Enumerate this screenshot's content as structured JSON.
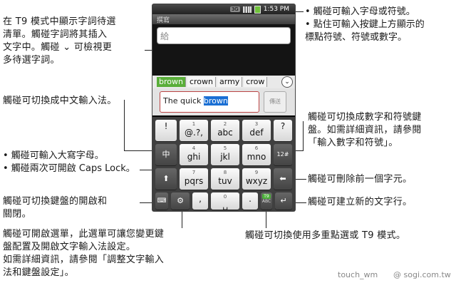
{
  "annotations": {
    "t9_candidates": "在 T9 模式中顯示字詞待選\n清單。觸碰字詞將其插入\n文字中。觸碰 ⌄ 可檢視更\n多待選字詞。",
    "chinese_input": "觸碰可切換成中文輸入法。",
    "caps": [
      "• 觸碰可輸入大寫字母。",
      "• 觸碰兩次可開啟 Caps Lock。"
    ],
    "keyboard_toggle": "觸碰可切換鍵盤的開啟和\n關閉。",
    "menu": "觸碰可開啟選單，此選單可讓您變更鍵\n盤配置及開啟文字輸入法設定。\n如需詳細資訊，請參閱「調整文字輸入\n法和鍵盤設定」。",
    "letters": [
      "• 觸碰可輸入字母或符號。",
      "• 點住可輸入按鍵上方顯示的\n  標點符號、符號或數字。"
    ],
    "numbers": "觸碰可切換成數字和符號鍵\n盤。如需詳細資訊，請參閱\n「輸入數字和符號」。",
    "delete": "觸碰可刪除前一個字元。",
    "enter": "觸碰可建立新的文字行。",
    "multitap": "觸碰可切換使用多重點選或 T9 模式。"
  },
  "phone": {
    "status_tag": "3G",
    "time": "1:53 PM",
    "title": "撰寫",
    "recipient_placeholder": "給",
    "candidates": [
      "brown",
      "crown",
      "army",
      "crow"
    ],
    "compose_text_before": "The quick ",
    "compose_text_selected": "brown",
    "send_label": "傳送",
    "keys": {
      "row1": [
        {
          "sub": "",
          "main": "!"
        },
        {
          "sub": "1",
          "main": "@.?,"
        },
        {
          "sub": "2",
          "main": "abc"
        },
        {
          "sub": "3",
          "main": "def"
        },
        {
          "sub": "",
          "main": "?"
        }
      ],
      "row2": [
        {
          "sub": "4",
          "main": "ghi"
        },
        {
          "sub": "5",
          "main": "jkl"
        },
        {
          "sub": "6",
          "main": "mno"
        }
      ],
      "row3": [
        {
          "sub": "7",
          "main": "pqrs"
        },
        {
          "sub": "8",
          "main": "tuv"
        },
        {
          "sub": "9",
          "main": "wxyz"
        }
      ],
      "row4": [
        {
          "sub": "",
          "main": ","
        },
        {
          "sub": "0",
          "main": "␣"
        },
        {
          "sub": "",
          "main": "."
        }
      ],
      "chinese_label": "中",
      "numbers_label": "12#",
      "t9_label": "T9",
      "t9_sub": "ABC"
    }
  },
  "watermarks": [
    "touch_wm",
    "@ sogi.com.tw"
  ]
}
